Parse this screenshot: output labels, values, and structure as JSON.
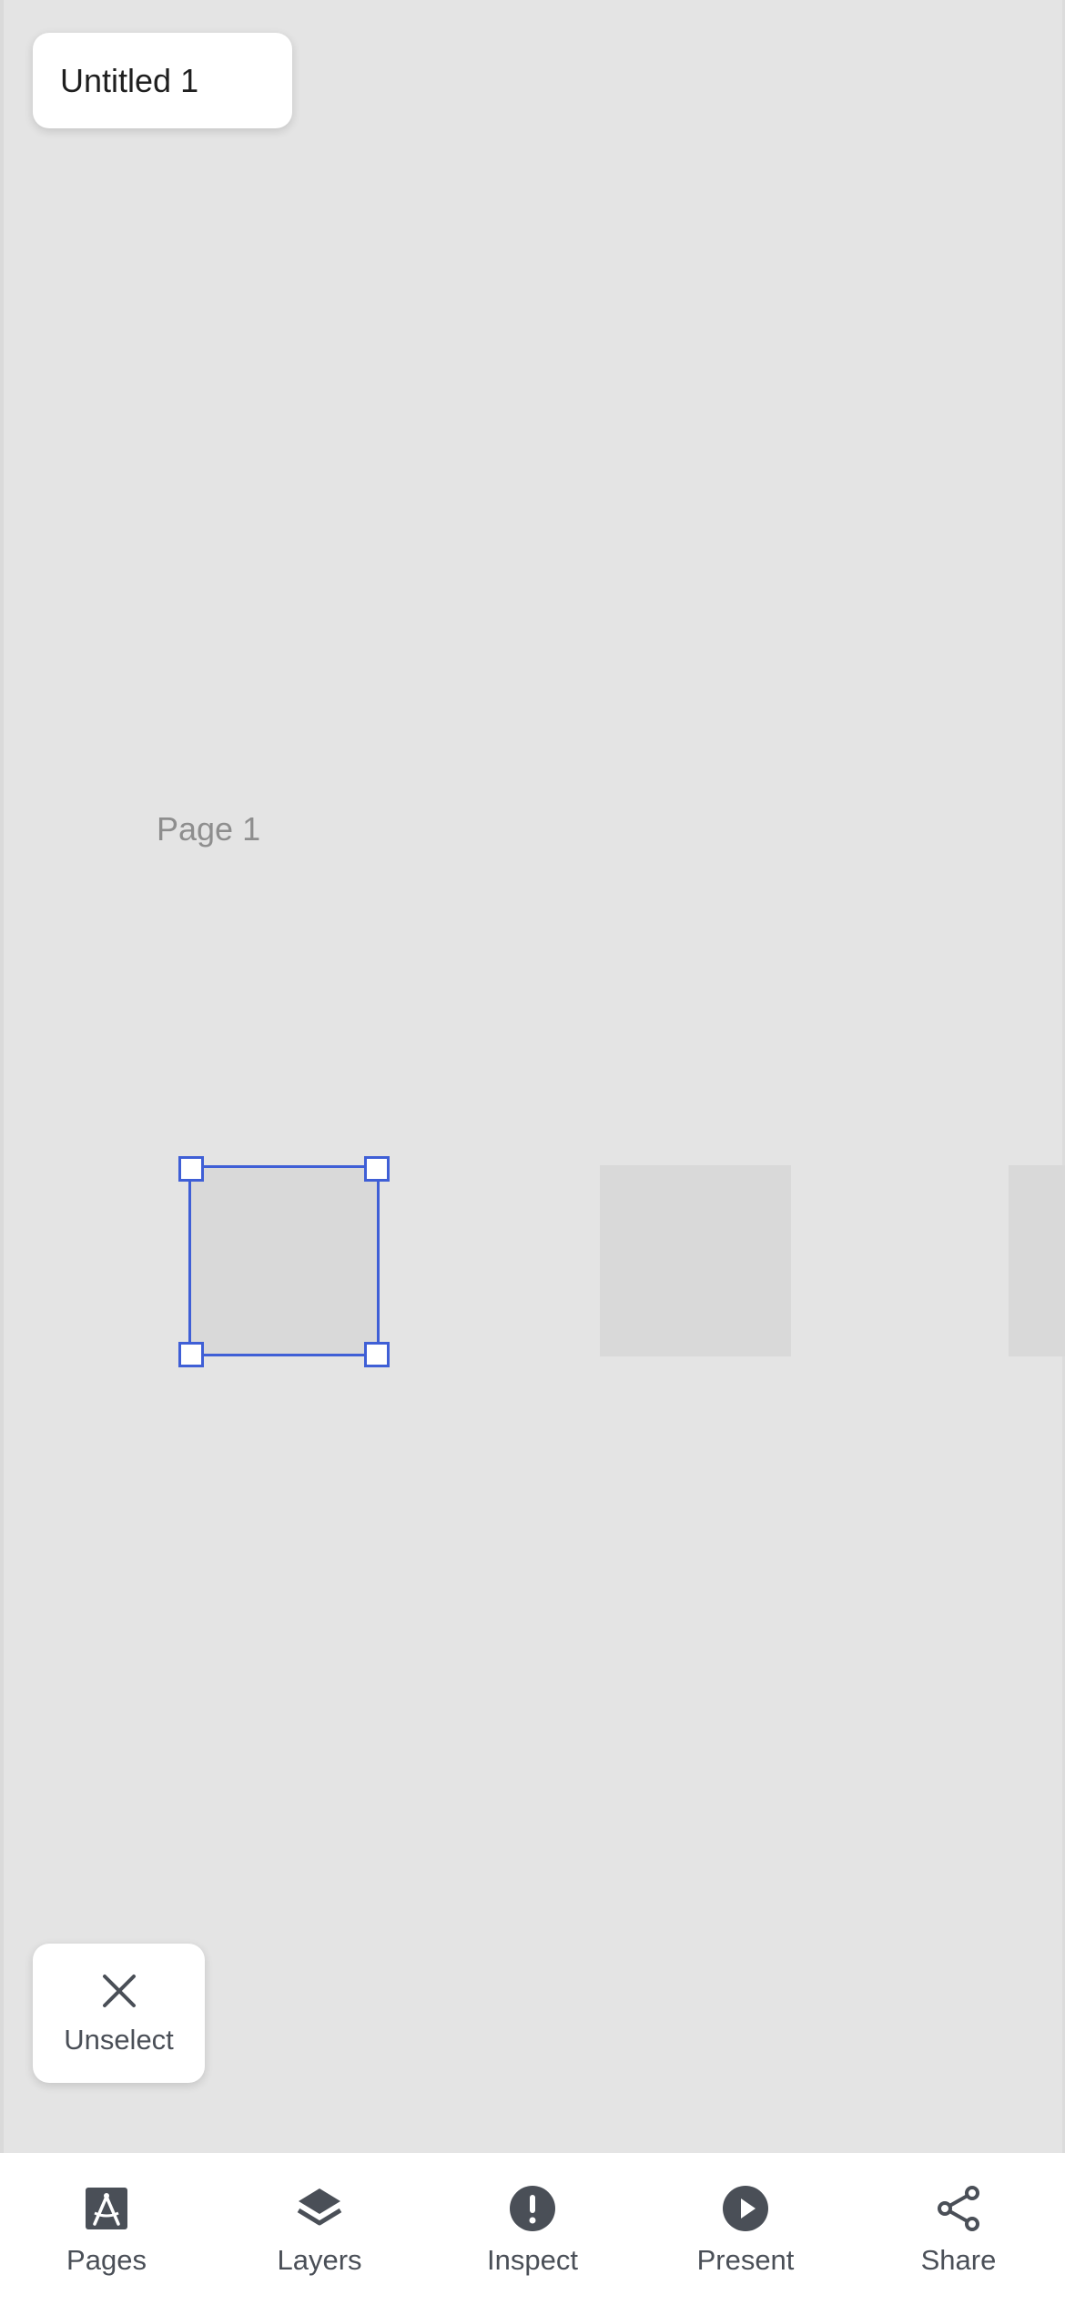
{
  "document": {
    "title": "Untitled 1"
  },
  "canvas": {
    "page_label": "Page 1"
  },
  "actions": {
    "unselect_label": "Unselect"
  },
  "bottom_nav": {
    "items": [
      {
        "label": "Pages",
        "icon": "pages-icon"
      },
      {
        "label": "Layers",
        "icon": "layers-icon"
      },
      {
        "label": "Inspect",
        "icon": "inspect-icon"
      },
      {
        "label": "Present",
        "icon": "present-icon"
      },
      {
        "label": "Share",
        "icon": "share-icon"
      }
    ]
  },
  "colors": {
    "canvas_bg": "#e4e4e4",
    "selection": "#3f5fd6",
    "shape_fill": "#d9d9d9",
    "icon": "#4a4f57"
  }
}
